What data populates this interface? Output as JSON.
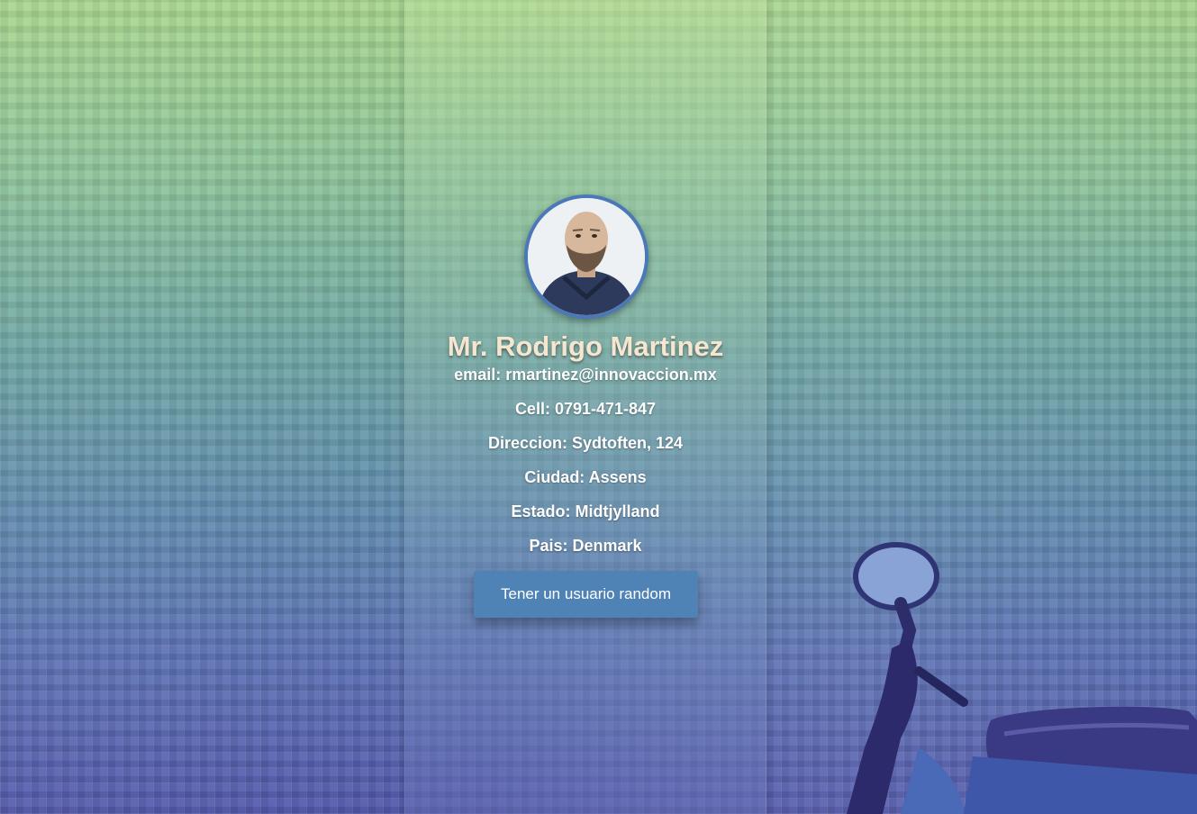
{
  "profile": {
    "name": "Mr. Rodrigo Martinez",
    "email": "email: rmartinez@innovaccion.mx",
    "cell": "Cell: 0791-471-847",
    "direccion": "Direccion: Sydtoften, 124",
    "ciudad": "Ciudad: Assens",
    "estado": "Estado: Midtjylland",
    "pais": "Pais: Denmark"
  },
  "actions": {
    "random_user_label": "Tener un usuario random"
  },
  "colors": {
    "button": "#4f83b6",
    "name_text": "#f7e6cf",
    "avatar_border": "#4a78b8"
  },
  "icons": {
    "avatar": "user-photo",
    "background_object": "scooter"
  }
}
